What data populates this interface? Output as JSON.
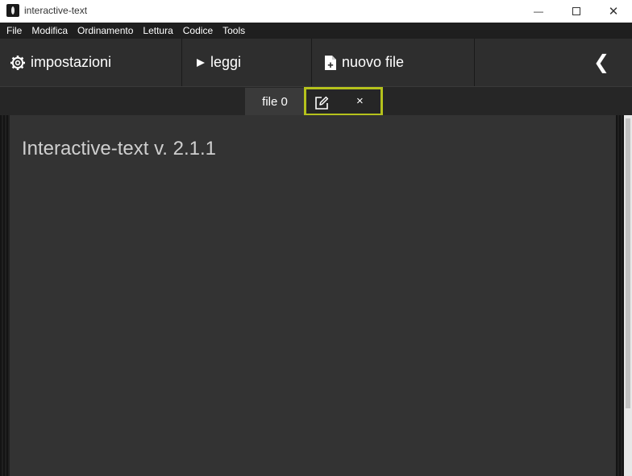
{
  "window": {
    "title": "interactive-text",
    "minimize_glyph": "—",
    "close_glyph": "✕"
  },
  "menu": [
    "File",
    "Modifica",
    "Ordinamento",
    "Lettura",
    "Codice",
    "Tools"
  ],
  "toolbar": {
    "settings_label": "impostazioni",
    "settings_icon": "gear-icon",
    "read_label": "leggi",
    "read_icon": "play-icon",
    "new_file_label": "nuovo file",
    "new_file_icon": "file-plus-icon",
    "back_glyph": "❮"
  },
  "tabs": {
    "active_label": "file 0",
    "close_glyph": "×"
  },
  "editor": {
    "content": "Interactive-text v. 2.1.1"
  },
  "colors": {
    "highlight": "#b5c21c",
    "menubar": "#1f1f1f",
    "toolbar": "#2e2e2e",
    "editor_bg": "#333333"
  }
}
